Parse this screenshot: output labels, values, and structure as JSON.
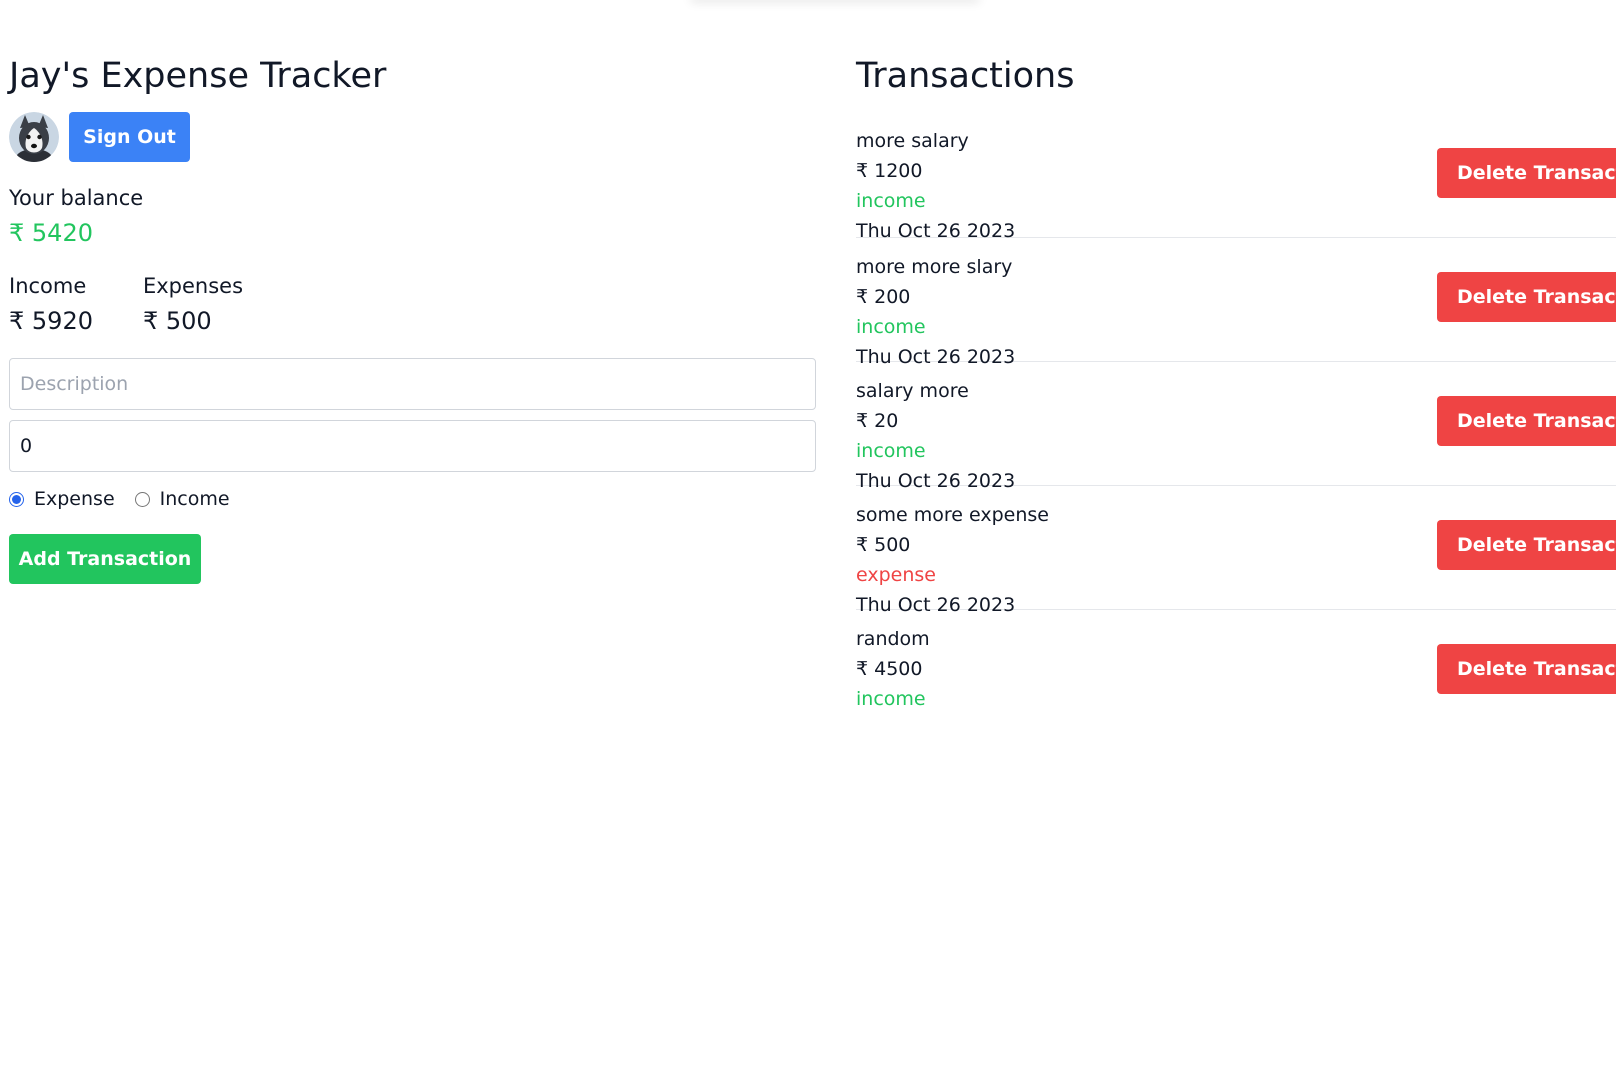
{
  "app": {
    "title": "Jay's Expense Tracker",
    "sign_out_label": "Sign Out"
  },
  "balance": {
    "label": "Your balance",
    "value": "₹ 5420"
  },
  "summary": {
    "income_label": "Income",
    "income_value": "₹ 5920",
    "expenses_label": "Expenses",
    "expenses_value": "₹ 500"
  },
  "form": {
    "description_placeholder": "Description",
    "amount_value": "0",
    "radio_expense_label": "Expense",
    "radio_income_label": "Income",
    "selected_type": "Expense",
    "add_label": "Add Transaction"
  },
  "transactions": {
    "title": "Transactions",
    "delete_label": "Delete Transaction",
    "items": [
      {
        "description": "more salary",
        "amount": "₹ 1200",
        "type": "income",
        "date": "Thu Oct 26 2023"
      },
      {
        "description": "more more slary",
        "amount": "₹ 200",
        "type": "income",
        "date": "Thu Oct 26 2023"
      },
      {
        "description": "salary more",
        "amount": "₹ 20",
        "type": "income",
        "date": "Thu Oct 26 2023"
      },
      {
        "description": "some more expense",
        "amount": "₹ 500",
        "type": "expense",
        "date": "Thu Oct 26 2023"
      },
      {
        "description": "random",
        "amount": "₹ 4500",
        "type": "income",
        "date": ""
      }
    ]
  },
  "colors": {
    "blue": "#3b82f6",
    "green": "#22c55e",
    "red": "#ef4444"
  },
  "icons": {
    "avatar": "husky-avatar-icon"
  }
}
